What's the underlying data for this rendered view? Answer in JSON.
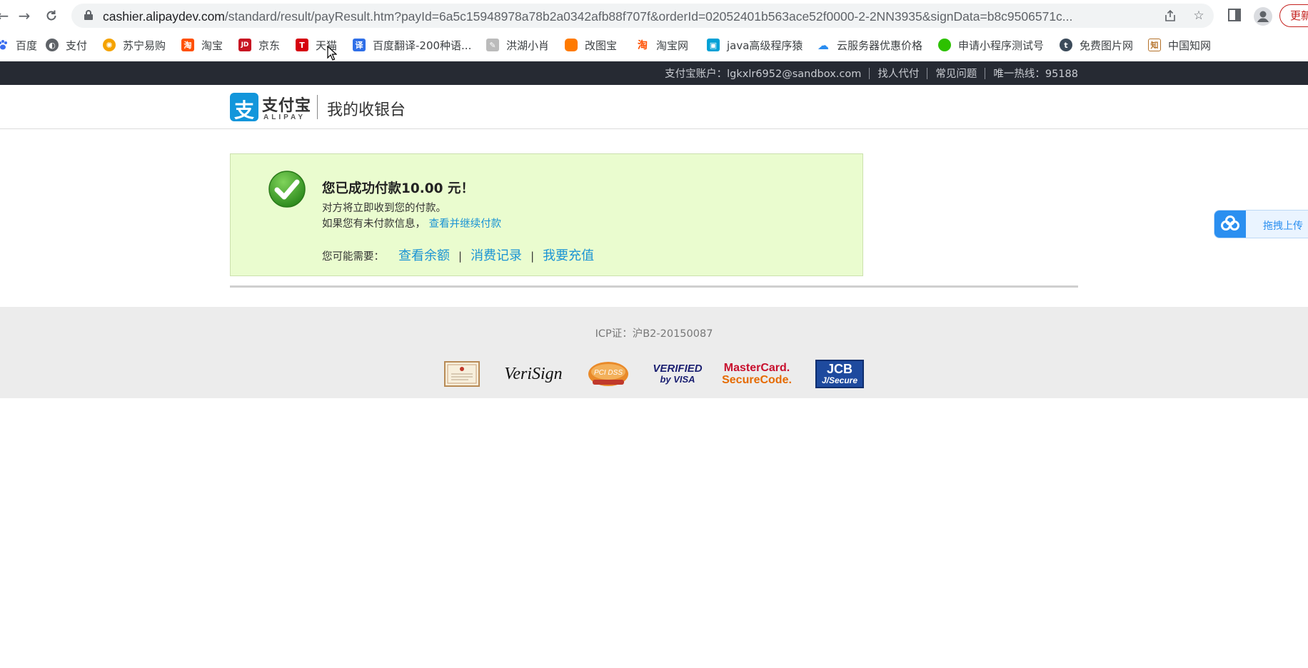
{
  "browser": {
    "url_host": "cashier.alipaydev.com",
    "url_path": "/standard/result/payResult.htm?payId=6a5c15948978a78b2a0342afb88f707f&orderId=02052401b563ace52f0000-2-2NN3935&signData=b8c9506571c...",
    "update_label": "更新",
    "icons": [
      "back-icon",
      "forward-icon",
      "reload-icon",
      "lock-icon",
      "share-icon",
      "star-icon",
      "sidepanel-icon",
      "profile-icon"
    ]
  },
  "bookmarks": [
    {
      "label": "百度",
      "icon": "baidu-icon",
      "color": "#3a6df0"
    },
    {
      "label": "支付",
      "icon": "globe-icon",
      "color": "#5f6368"
    },
    {
      "label": "苏宁易购",
      "icon": "suning-icon",
      "color": "#f5a300"
    },
    {
      "label": "淘宝",
      "icon": "taobao-icon",
      "color": "#ff5000"
    },
    {
      "label": "京东",
      "icon": "jd-icon",
      "color": "#c81623"
    },
    {
      "label": "天猫",
      "icon": "tmall-icon",
      "color": "#d6000f"
    },
    {
      "label": "百度翻译-200种语...",
      "icon": "translate-icon",
      "color": "#2f6fe8"
    },
    {
      "label": "洪湖小肖",
      "icon": "bird-icon",
      "color": "#888888"
    },
    {
      "label": "改图宝",
      "icon": "gaitubao-icon",
      "color": "#ff7a00"
    },
    {
      "label": "淘宝网",
      "icon": "taobao-net-icon",
      "color": "#ff5000"
    },
    {
      "label": "java高级程序猿",
      "icon": "bilibili-icon",
      "color": "#00a1d6"
    },
    {
      "label": "云服务器优惠价格",
      "icon": "cloud-icon",
      "color": "#2a8cf0"
    },
    {
      "label": "申请小程序测试号",
      "icon": "wechat-icon",
      "color": "#2dc100"
    },
    {
      "label": "免费图片网",
      "icon": "t-icon",
      "color": "#3c4b5a"
    },
    {
      "label": "中国知网",
      "icon": "cnki-icon",
      "color": "#b4722a"
    }
  ],
  "topbar": {
    "account": "支付宝账户：lgkxlr6952@sandbox.com",
    "find_payer": "找人代付",
    "faq": "常见问题",
    "hotline": "唯一热线：95188"
  },
  "header": {
    "logo_glyph": "支",
    "logo_text": "支付宝",
    "logo_sub": "ALIPAY",
    "title": "我的收银台"
  },
  "result": {
    "title": "您已成功付款10.00 元！",
    "line1": "对方将立即收到您的付款。",
    "line2_prefix": "如果您有未付款信息，",
    "line2_link": "查看并继续付款",
    "maybe_label": "您可能需要：",
    "links": [
      "查看余额",
      "消费记录",
      "我要充值"
    ]
  },
  "footer": {
    "icp": "ICP证：沪B2-20150087",
    "certs": {
      "verisign": "VeriSign",
      "pcidss": "PCI DSS",
      "visa_top": "VERIFIED",
      "visa_bottom": "by VISA",
      "mc_top": "MasterCard.",
      "mc_bottom": "SecureCode.",
      "jcb_top": "JCB",
      "jcb_bottom": "J/Secure"
    }
  },
  "upload_widget": {
    "label": "拖拽上传"
  }
}
